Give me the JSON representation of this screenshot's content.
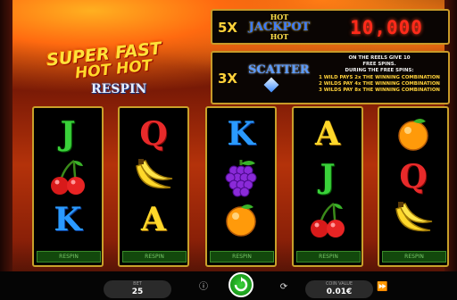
{
  "logo": {
    "line1": "SUPER FAST",
    "line2": "HOT HOT",
    "line3": "RESPIN"
  },
  "jackpot": {
    "multiplier": "5X",
    "top": "HOT",
    "main": "JACKPOT",
    "bottom": "HOT",
    "value": "10,000"
  },
  "scatter": {
    "multiplier": "3X",
    "title": "SCATTER",
    "info_lines": [
      "ON THE REELS GIVE 10",
      "FREE SPINS.",
      "DURING THE FREE SPINS:",
      "1 WILD PAYS 2x THE WINNING COMBINATION",
      "2 WILDS PAY 4x THE WINNING COMBINATION",
      "3 WILDS PAY 8x THE WINNING COMBINATION"
    ]
  },
  "reels": [
    {
      "symbols": [
        "J",
        "cherry",
        "K"
      ],
      "respin_label": "RESPIN"
    },
    {
      "symbols": [
        "Q",
        "banana",
        "A"
      ],
      "respin_label": "RESPIN"
    },
    {
      "symbols": [
        "K",
        "grapes",
        "orange"
      ],
      "respin_label": "RESPIN"
    },
    {
      "symbols": [
        "A",
        "J",
        "cherry"
      ],
      "respin_label": "RESPIN"
    },
    {
      "symbols": [
        "orange",
        "Q",
        "banana"
      ],
      "respin_label": "RESPIN"
    }
  ],
  "controls": {
    "bet_caption": "BET",
    "bet_value": "25",
    "coin_caption": "COIN VALUE",
    "coin_value": "0.01€",
    "info_icon": "info-icon",
    "spin_icon": "spin-arrows-icon",
    "autoplay_icon": "autoplay-icon",
    "turbo_icon": "turbo-icon"
  },
  "colors": {
    "accent_gold": "#c8a02a",
    "jackpot_red": "#ff2a1a",
    "spin_green": "#2ab42a"
  }
}
